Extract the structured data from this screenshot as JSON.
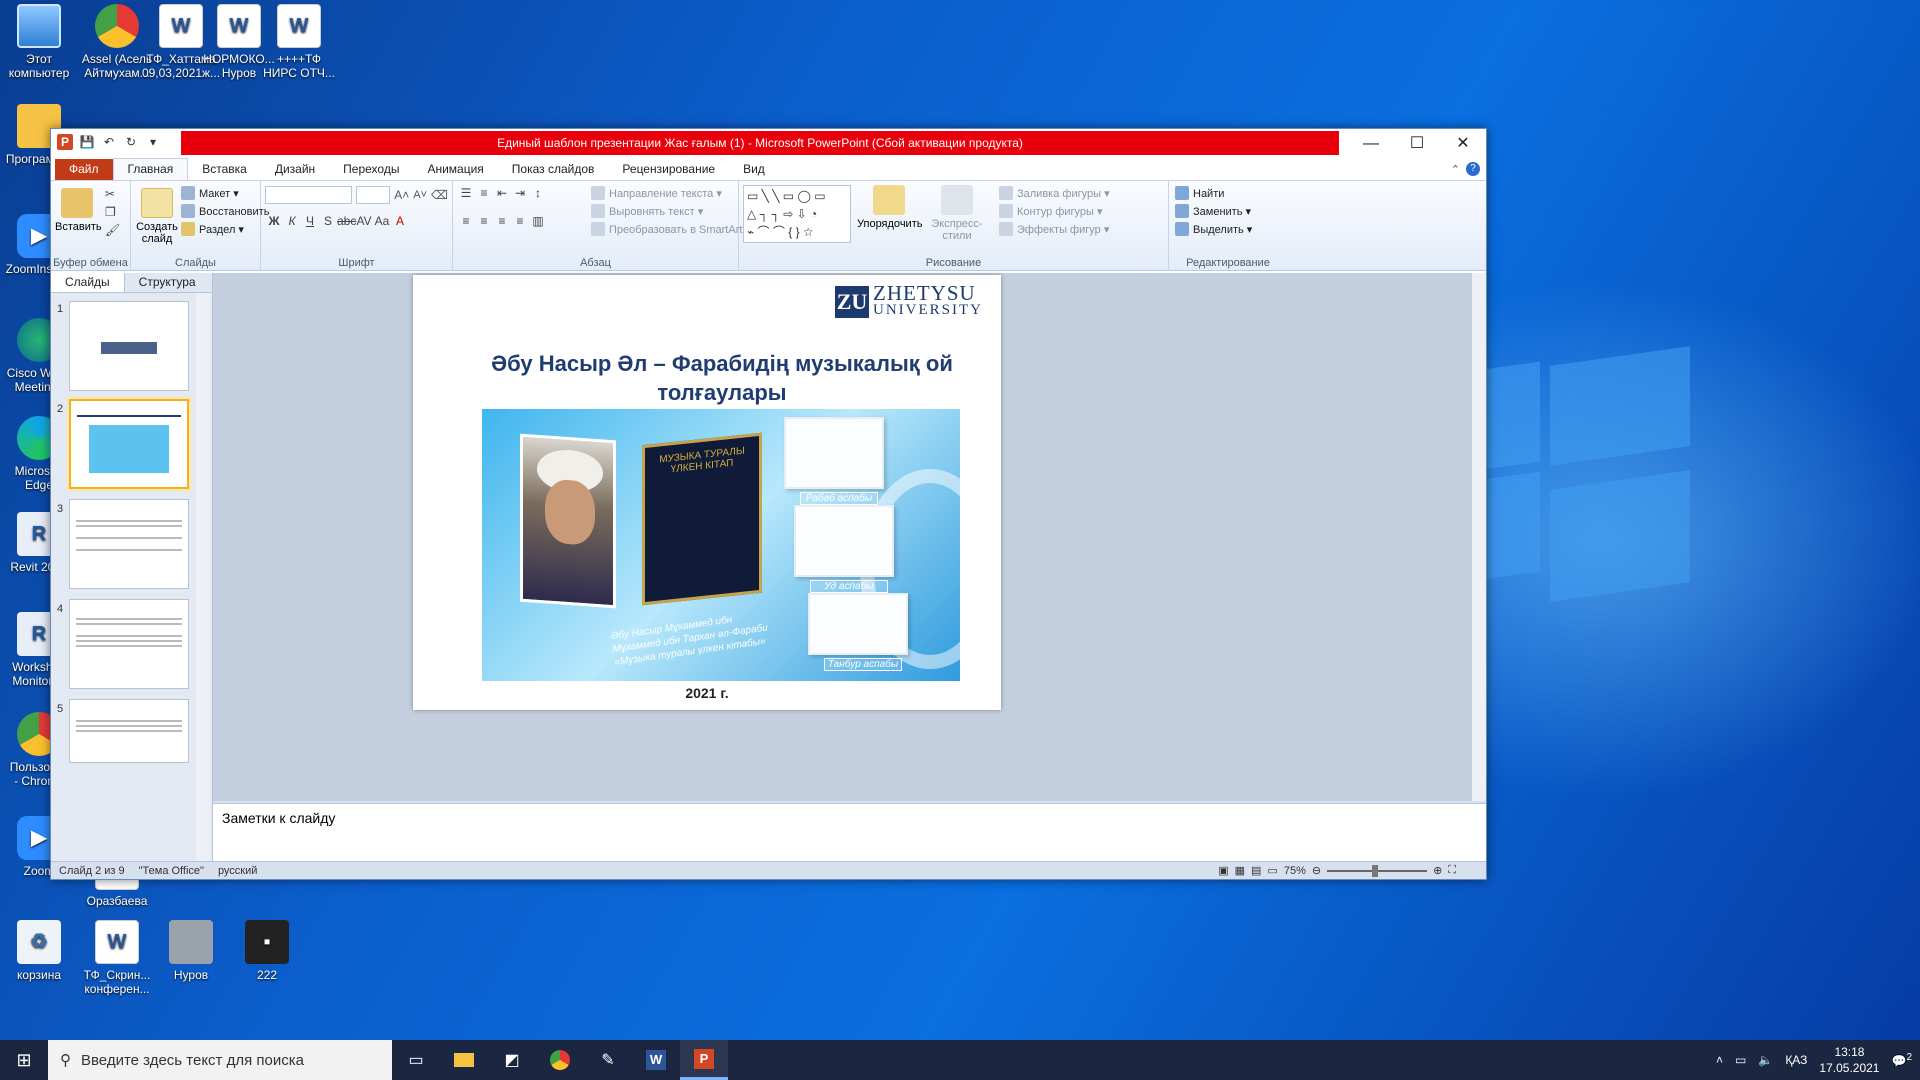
{
  "desktop": {
    "icons": [
      {
        "name": "this-pc",
        "label": "Этот\nкомпьютер",
        "kind": "pc"
      },
      {
        "name": "chrome-assel",
        "label": "Assel (Асель\nАйтмухам...",
        "kind": "chrome"
      },
      {
        "name": "doc-tf-hattama",
        "label": "ТФ_Хаттама\n09,03,2021ж...",
        "kind": "word"
      },
      {
        "name": "doc-normoko",
        "label": "НОРМОКО...\nНуров",
        "kind": "word"
      },
      {
        "name": "doc-tf-nirs",
        "label": "++++ТФ\nНИРС ОТЧ...",
        "kind": "word"
      },
      {
        "name": "programs",
        "label": "Программ...",
        "kind": "folder"
      },
      {
        "name": "zoom-installer",
        "label": "ZoomInsta...",
        "kind": "blue"
      },
      {
        "name": "cisco-webex",
        "label": "Cisco Webe\nMeetings",
        "kind": "cisco"
      },
      {
        "name": "microsoft-edge",
        "label": "Microsoft\nEdge",
        "kind": "edge"
      },
      {
        "name": "revit",
        "label": "Revit 2019",
        "kind": "revit"
      },
      {
        "name": "worksharing-monitor",
        "label": "Workshari\nMonitor fo",
        "kind": "revit"
      },
      {
        "name": "chrome-user",
        "label": "Пользоват\n- Chrome",
        "kind": "chrome"
      },
      {
        "name": "zoom",
        "label": "Zoom",
        "kind": "blue"
      },
      {
        "name": "orazbaeva",
        "label": "Оразбаева",
        "kind": "word"
      },
      {
        "name": "recycle-bin",
        "label": "корзина",
        "kind": "bin"
      },
      {
        "name": "doc-tf-skrin",
        "label": "ТФ_Скрин...\nконферен...",
        "kind": "word"
      },
      {
        "name": "nurov",
        "label": "Нуров",
        "kind": "gray"
      },
      {
        "name": "file-222",
        "label": "222",
        "kind": "dark"
      }
    ]
  },
  "window": {
    "title": "Единый шаблон презентации Жас ғалым (1) - Microsoft PowerPoint (Сбой активации продукта)",
    "tabs": [
      "Файл",
      "Главная",
      "Вставка",
      "Дизайн",
      "Переходы",
      "Анимация",
      "Показ слайдов",
      "Рецензирование",
      "Вид"
    ],
    "active_tab": "Главная"
  },
  "ribbon": {
    "clipboard": {
      "paste": "Вставить",
      "label": "Буфер обмена"
    },
    "slides": {
      "new_slide": "Создать слайд",
      "layout": "Макет",
      "reset": "Восстановить",
      "section": "Раздел",
      "label": "Слайды"
    },
    "font": {
      "label": "Шрифт"
    },
    "paragraph": {
      "text_direction": "Направление текста",
      "align_text": "Выровнять текст",
      "smartart": "Преобразовать в SmartArt",
      "label": "Абзац"
    },
    "drawing": {
      "arrange": "Упорядочить",
      "quick_styles": "Экспресс-стили",
      "shape_fill": "Заливка фигуры",
      "shape_outline": "Контур фигуры",
      "shape_effects": "Эффекты фигур",
      "label": "Рисование"
    },
    "editing": {
      "find": "Найти",
      "replace": "Заменить",
      "select": "Выделить",
      "label": "Редактирование"
    }
  },
  "pane": {
    "tab_slides": "Слайды",
    "tab_outline": "Структура",
    "close": "×",
    "numbers": [
      "1",
      "2",
      "3",
      "4",
      "5"
    ]
  },
  "slide": {
    "logo_mark": "ZU",
    "logo_line1": "ZHETYSU",
    "logo_line2": "UNIVERSITY",
    "title": "Әбу Насыр Әл – Фарабидің музыкалық ой толғаулары",
    "book_title": "МУЗЫКА ТУРАЛЫ ҮЛКЕН КІТАП",
    "caption": "Әбу Насыр Мұхаммед ибн Мұхаммед ибн Тархан әл-Фараби «Музыка туралы үлкен кітабы»",
    "instruments": [
      "Рабаб аспабы",
      "Уд аспабы",
      "Танбур аспабы"
    ],
    "year": "2021 г."
  },
  "notes": {
    "placeholder": "Заметки к слайду"
  },
  "status": {
    "slide_info": "Слайд 2 из 9",
    "theme": "\"Тема Office\"",
    "language": "русский",
    "zoom": "75%"
  },
  "taskbar": {
    "search_placeholder": "Введите здесь текст для поиска",
    "language": "ҚАЗ",
    "time": "13:18",
    "date": "17.05.2021",
    "notifications": "2"
  }
}
